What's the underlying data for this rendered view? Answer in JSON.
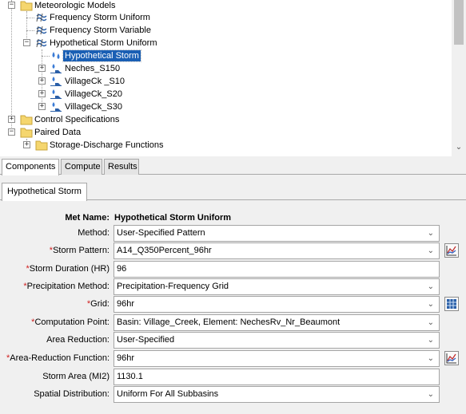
{
  "tree": {
    "items": [
      {
        "label": "Meteorologic Models"
      },
      {
        "label": "Frequency Storm Uniform"
      },
      {
        "label": "Frequency Storm Variable"
      },
      {
        "label": "Hypothetical Storm Uniform"
      },
      {
        "label": "Hypothetical Storm"
      },
      {
        "label": "Neches_S150"
      },
      {
        "label": "VillageCk _S10"
      },
      {
        "label": "VillageCk_S20"
      },
      {
        "label": "VillageCk_S30"
      },
      {
        "label": "Control Specifications"
      },
      {
        "label": "Paired Data"
      },
      {
        "label": "Storage-Discharge Functions"
      }
    ]
  },
  "bottom_tabs": [
    "Components",
    "Compute",
    "Results"
  ],
  "editor": {
    "tab_label": "Hypothetical Storm",
    "met_name_label": "Met Name:",
    "met_name_value": "Hypothetical Storm Uniform",
    "fields": [
      {
        "label": "Method:",
        "required": false,
        "value": "User-Specified Pattern",
        "kind": "combo"
      },
      {
        "label": "Storm Pattern:",
        "required": true,
        "value": "A14_Q350Percent_96hr",
        "kind": "combo",
        "side_icon": "chart-icon"
      },
      {
        "label": "Storm Duration (HR)",
        "required": true,
        "value": "96",
        "kind": "field"
      },
      {
        "label": "Precipitation Method:",
        "required": true,
        "value": "Precipitation-Frequency Grid",
        "kind": "combo"
      },
      {
        "label": "Grid:",
        "required": true,
        "value": "96hr",
        "kind": "combo",
        "side_icon": "grid-icon"
      },
      {
        "label": "Computation Point:",
        "required": true,
        "value": "Basin: Village_Creek, Element: NechesRv_Nr_Beaumont",
        "kind": "combo"
      },
      {
        "label": "Area Reduction:",
        "required": false,
        "value": "User-Specified",
        "kind": "combo"
      },
      {
        "label": "Area-Reduction Function:",
        "required": true,
        "value": "96hr",
        "kind": "combo",
        "side_icon": "chart-icon"
      },
      {
        "label": "Storm Area (MI2)",
        "required": false,
        "value": "1130.1",
        "kind": "field"
      },
      {
        "label": "Spatial Distribution:",
        "required": false,
        "value": "Uniform For All Subbasins",
        "kind": "combo"
      }
    ],
    "required_marker": "*"
  },
  "colors": {
    "selection": "#1a5fb4",
    "required": "#d02020",
    "folder": "#f5d66e"
  }
}
